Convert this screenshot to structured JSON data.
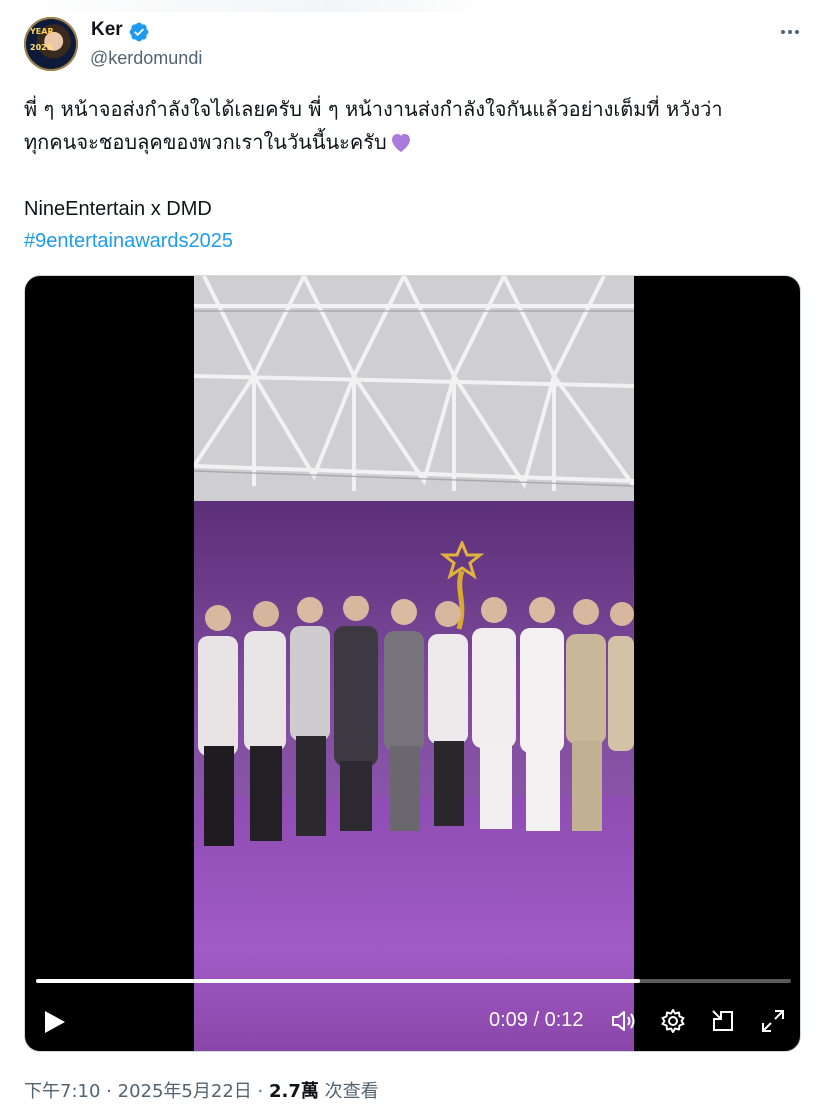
{
  "author": {
    "display_name": "Ker",
    "handle": "@kerdomundi",
    "verified": true,
    "avatar_text_top": "YEAR",
    "avatar_text_bottom": "2025"
  },
  "tweet": {
    "text_line_1": "พี่ ๆ หน้าจอส่งกำลังใจได้เลยครับ พี่ ๆ หน้างานส่งกำลังใจกันแล้วอย่างเต็มที่ หวังว่า",
    "text_line_2": "ทุกคนจะชอบลุคของพวกเราในวันนี้นะครับ",
    "credit": "NineEntertain x DMD",
    "hashtag": "#9entertainawards2025",
    "heart_emoji": "purple-heart"
  },
  "video": {
    "current_time": "0:09",
    "duration": "0:12",
    "time_display": "0:09 / 0:12",
    "progress_fraction": 0.8
  },
  "meta": {
    "time": "下午7:10",
    "date": "2025年5月22日",
    "separator": "·",
    "views_count": "2.7萬",
    "views_label": "次查看"
  },
  "icons": {
    "verified": "verified-badge-icon",
    "more": "more-options-icon",
    "play": "play-icon",
    "volume": "volume-icon",
    "settings": "settings-icon",
    "pip": "picture-in-picture-icon",
    "fullscreen": "fullscreen-icon"
  },
  "colors": {
    "link": "#1d9bf0",
    "verified": "#1d9bf0",
    "secondary_text": "#536471",
    "heart": "#a97bdc"
  }
}
